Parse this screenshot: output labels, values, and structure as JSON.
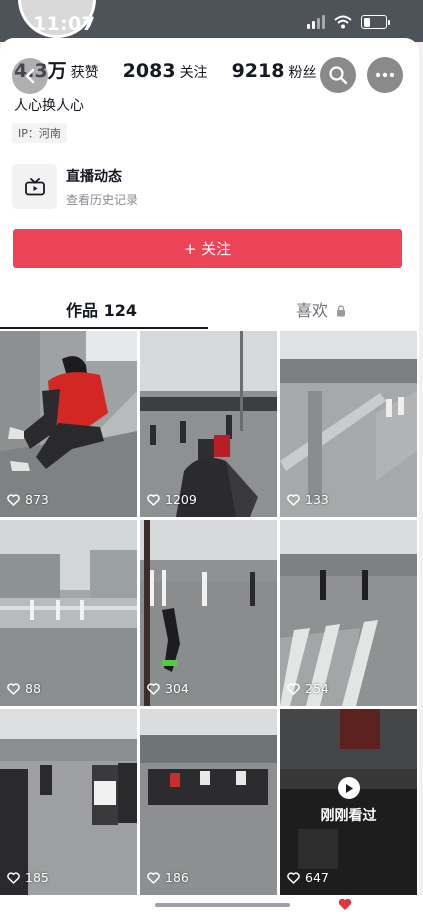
{
  "status_bar": {
    "time": "11:07",
    "icons": [
      "location-arrow-icon",
      "cellular-signal-icon",
      "wifi-icon",
      "battery-icon"
    ]
  },
  "profile": {
    "stats": [
      {
        "value": "4.3万",
        "label": "获赞"
      },
      {
        "value": "2083",
        "label": "关注"
      },
      {
        "value": "9218",
        "label": "粉丝"
      }
    ],
    "bio": "人心换人心",
    "ip_location": "IP：河南"
  },
  "live": {
    "title": "直播动态",
    "subtitle": "查看历史记录"
  },
  "follow_button": {
    "label": "+ 关注"
  },
  "tabs": [
    {
      "label": "作品 124",
      "active": true
    },
    {
      "label": "喜欢",
      "locked": true
    }
  ],
  "videos": [
    {
      "likes": "873"
    },
    {
      "likes": "1209"
    },
    {
      "likes": "133"
    },
    {
      "likes": "88"
    },
    {
      "likes": "304"
    },
    {
      "likes": "254"
    },
    {
      "likes": "185"
    },
    {
      "likes": "186"
    },
    {
      "likes": "647",
      "overlay": "刚刚看过"
    }
  ],
  "colors": {
    "accent": "#ec4357",
    "text": "#161823",
    "status_bar": "#4d5358"
  }
}
